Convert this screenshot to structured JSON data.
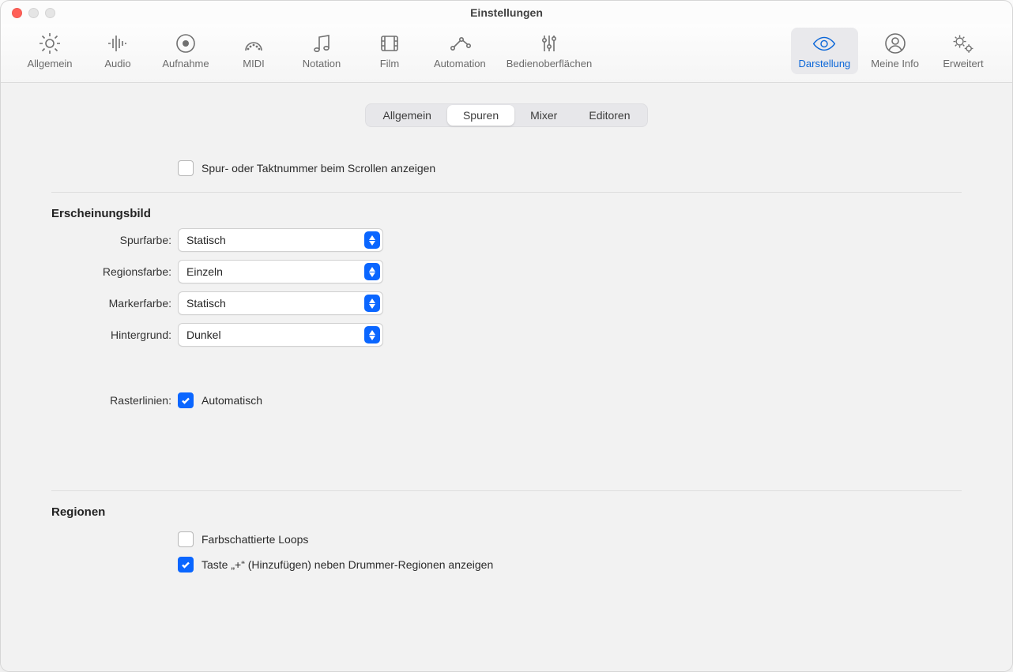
{
  "window": {
    "title": "Einstellungen"
  },
  "toolbar": [
    {
      "id": "allgemein",
      "label": "Allgemein",
      "icon": "gear"
    },
    {
      "id": "audio",
      "label": "Audio",
      "icon": "audio"
    },
    {
      "id": "aufnahme",
      "label": "Aufnahme",
      "icon": "record"
    },
    {
      "id": "midi",
      "label": "MIDI",
      "icon": "midi"
    },
    {
      "id": "notation",
      "label": "Notation",
      "icon": "notation"
    },
    {
      "id": "film",
      "label": "Film",
      "icon": "film"
    },
    {
      "id": "automation",
      "label": "Automation",
      "icon": "automation"
    },
    {
      "id": "bedien",
      "label": "Bedienoberflächen",
      "icon": "sliders"
    },
    {
      "id": "darstellung",
      "label": "Darstellung",
      "icon": "eye",
      "active": true
    },
    {
      "id": "meineinfo",
      "label": "Meine Info",
      "icon": "user"
    },
    {
      "id": "erweitert",
      "label": "Erweitert",
      "icon": "gears"
    }
  ],
  "tabs": [
    {
      "id": "allgemein",
      "label": "Allgemein"
    },
    {
      "id": "spuren",
      "label": "Spuren",
      "active": true
    },
    {
      "id": "mixer",
      "label": "Mixer"
    },
    {
      "id": "editoren",
      "label": "Editoren"
    }
  ],
  "topCheckbox": {
    "label": "Spur- oder Taktnummer beim Scrollen anzeigen",
    "checked": false
  },
  "sections": {
    "appearance": {
      "title": "Erscheinungsbild",
      "fields": {
        "trackColor": {
          "label": "Spurfarbe:",
          "value": "Statisch"
        },
        "regionColor": {
          "label": "Regionsfarbe:",
          "value": "Einzeln"
        },
        "markerColor": {
          "label": "Markerfarbe:",
          "value": "Statisch"
        },
        "background": {
          "label": "Hintergrund:",
          "value": "Dunkel"
        }
      },
      "gridlines": {
        "label": "Rasterlinien:",
        "checkLabel": "Automatisch",
        "checked": true
      }
    },
    "regions": {
      "title": "Regionen",
      "loops": {
        "label": "Farbschattierte Loops",
        "checked": false
      },
      "plusKey": {
        "label": "Taste „+“ (Hinzufügen) neben Drummer-Regionen anzeigen",
        "checked": true
      }
    }
  }
}
